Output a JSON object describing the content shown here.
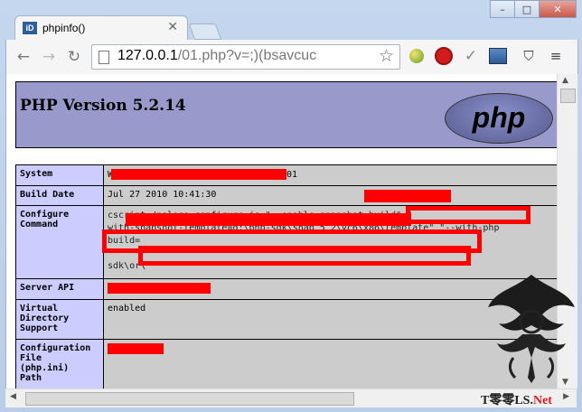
{
  "window": {
    "minimize": "–",
    "maximize": "□",
    "close": "✕"
  },
  "tab": {
    "favicon": "iD",
    "title": "phpinfo()",
    "close": "✕"
  },
  "toolbar": {
    "back": "←",
    "forward": "→",
    "reload": "↻",
    "url_host": "127.0.0.1",
    "url_path": "/01.php?v=;)(bsavcuc",
    "star": "☆"
  },
  "icons": {
    "back": "back-arrow-icon",
    "forward": "forward-arrow-icon",
    "reload": "reload-icon",
    "bookmark": "star-icon",
    "page": "page-icon"
  },
  "php": {
    "title": "PHP Version 5.2.14",
    "logo": "php"
  },
  "rows": [
    {
      "label": "System",
      "value_suffix": "01"
    },
    {
      "label": "Build Date",
      "value": "Jul 27 2010 10:41:30"
    },
    {
      "label": "Configure\nCommand",
      "lines": [
        "cscript /nologo configure.js \"--enable-snapshot-build\" \"",
        "with-snapshot-template=d:\\php-sdk\\snap_5_2\\vc6\\x86\\template\" \"--with-php",
        "build=",
        "",
        "sdk\\or\\"
      ]
    },
    {
      "label": "Server API"
    },
    {
      "label": "Virtual\nDirectory\nSupport",
      "value": "enabled"
    },
    {
      "label": "Configuration\nFile\n(php.ini)\nPath"
    }
  ],
  "watermark": {
    "text_main": "T零零LS.",
    "text_net": "Net"
  },
  "colors": {
    "php_header": "#9999cc",
    "label_cell": "#ccccff",
    "value_cell": "#cccccc",
    "redaction": "#ff0000"
  }
}
